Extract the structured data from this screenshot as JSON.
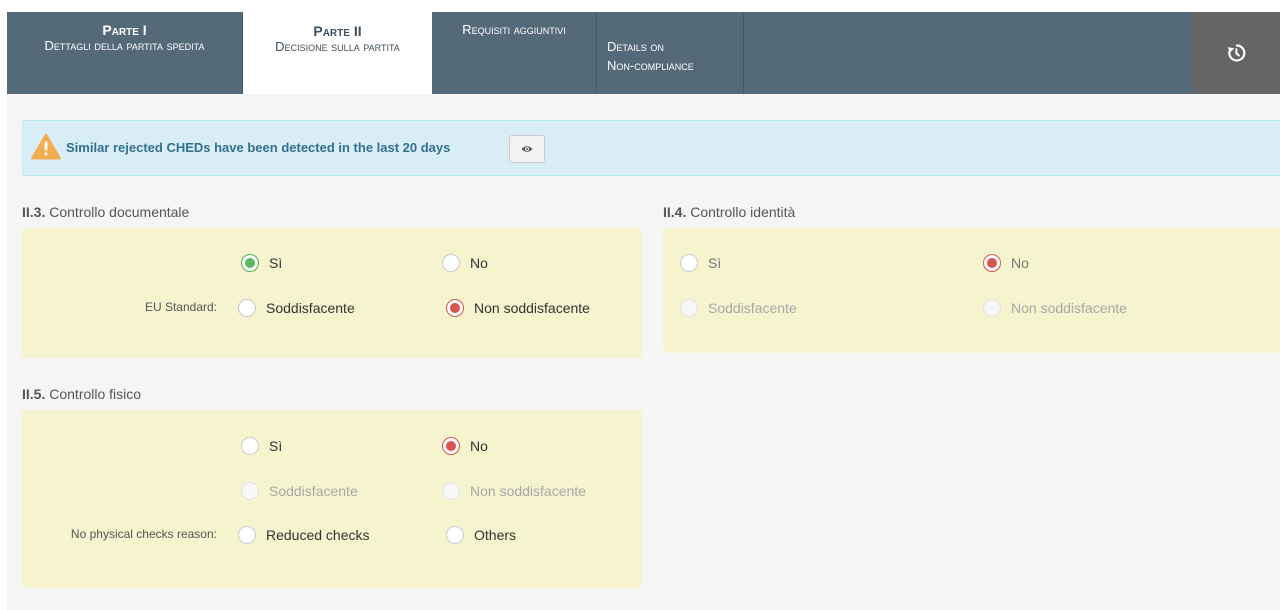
{
  "tabs": [
    {
      "title": "Parte I",
      "subtitle": "Dettagli della partita spedita"
    },
    {
      "title": "Parte II",
      "subtitle": "Decisione sulla partita"
    },
    {
      "title": "Requisiti aggiuntivi"
    },
    {
      "line1": "Details on",
      "line2": "Non-compliance"
    }
  ],
  "restore_icon": "history-icon",
  "alert": {
    "icon": "warning-triangle-icon",
    "text": "Similar rejected CHEDs have been detected in the last 20 days",
    "button_icon": "eye-icon"
  },
  "documentary_check": {
    "number": "II.3.",
    "title": "Controllo documentale",
    "options": {
      "yes": "Sì",
      "no": "No"
    },
    "selected": "yes",
    "eu_standard_label": "EU Standard:",
    "eu_options": {
      "satisfactory": "Soddisfacente",
      "not_satisfactory": "Non soddisfacente"
    },
    "eu_selected": "not_satisfactory"
  },
  "identity_check": {
    "number": "II.4.",
    "title": "Controllo identità",
    "options": {
      "yes": "Sì",
      "no": "No"
    },
    "selected": "no",
    "result_options": {
      "satisfactory": "Soddisfacente",
      "not_satisfactory": "Non soddisfacente"
    }
  },
  "physical_check": {
    "number": "II.5.",
    "title": "Controllo fisico",
    "options": {
      "yes": "Sì",
      "no": "No"
    },
    "selected": "no",
    "result_options": {
      "satisfactory": "Soddisfacente",
      "not_satisfactory": "Non soddisfacente"
    },
    "reason_label": "No physical checks reason:",
    "reason_options": {
      "reduced": "Reduced checks",
      "others": "Others"
    }
  },
  "colors": {
    "tabbar": "#546a78",
    "panel": "#f6f3cf",
    "alert_bg": "#d9edf7",
    "radio_green": "#5cb85c",
    "radio_red": "#d9534f"
  }
}
